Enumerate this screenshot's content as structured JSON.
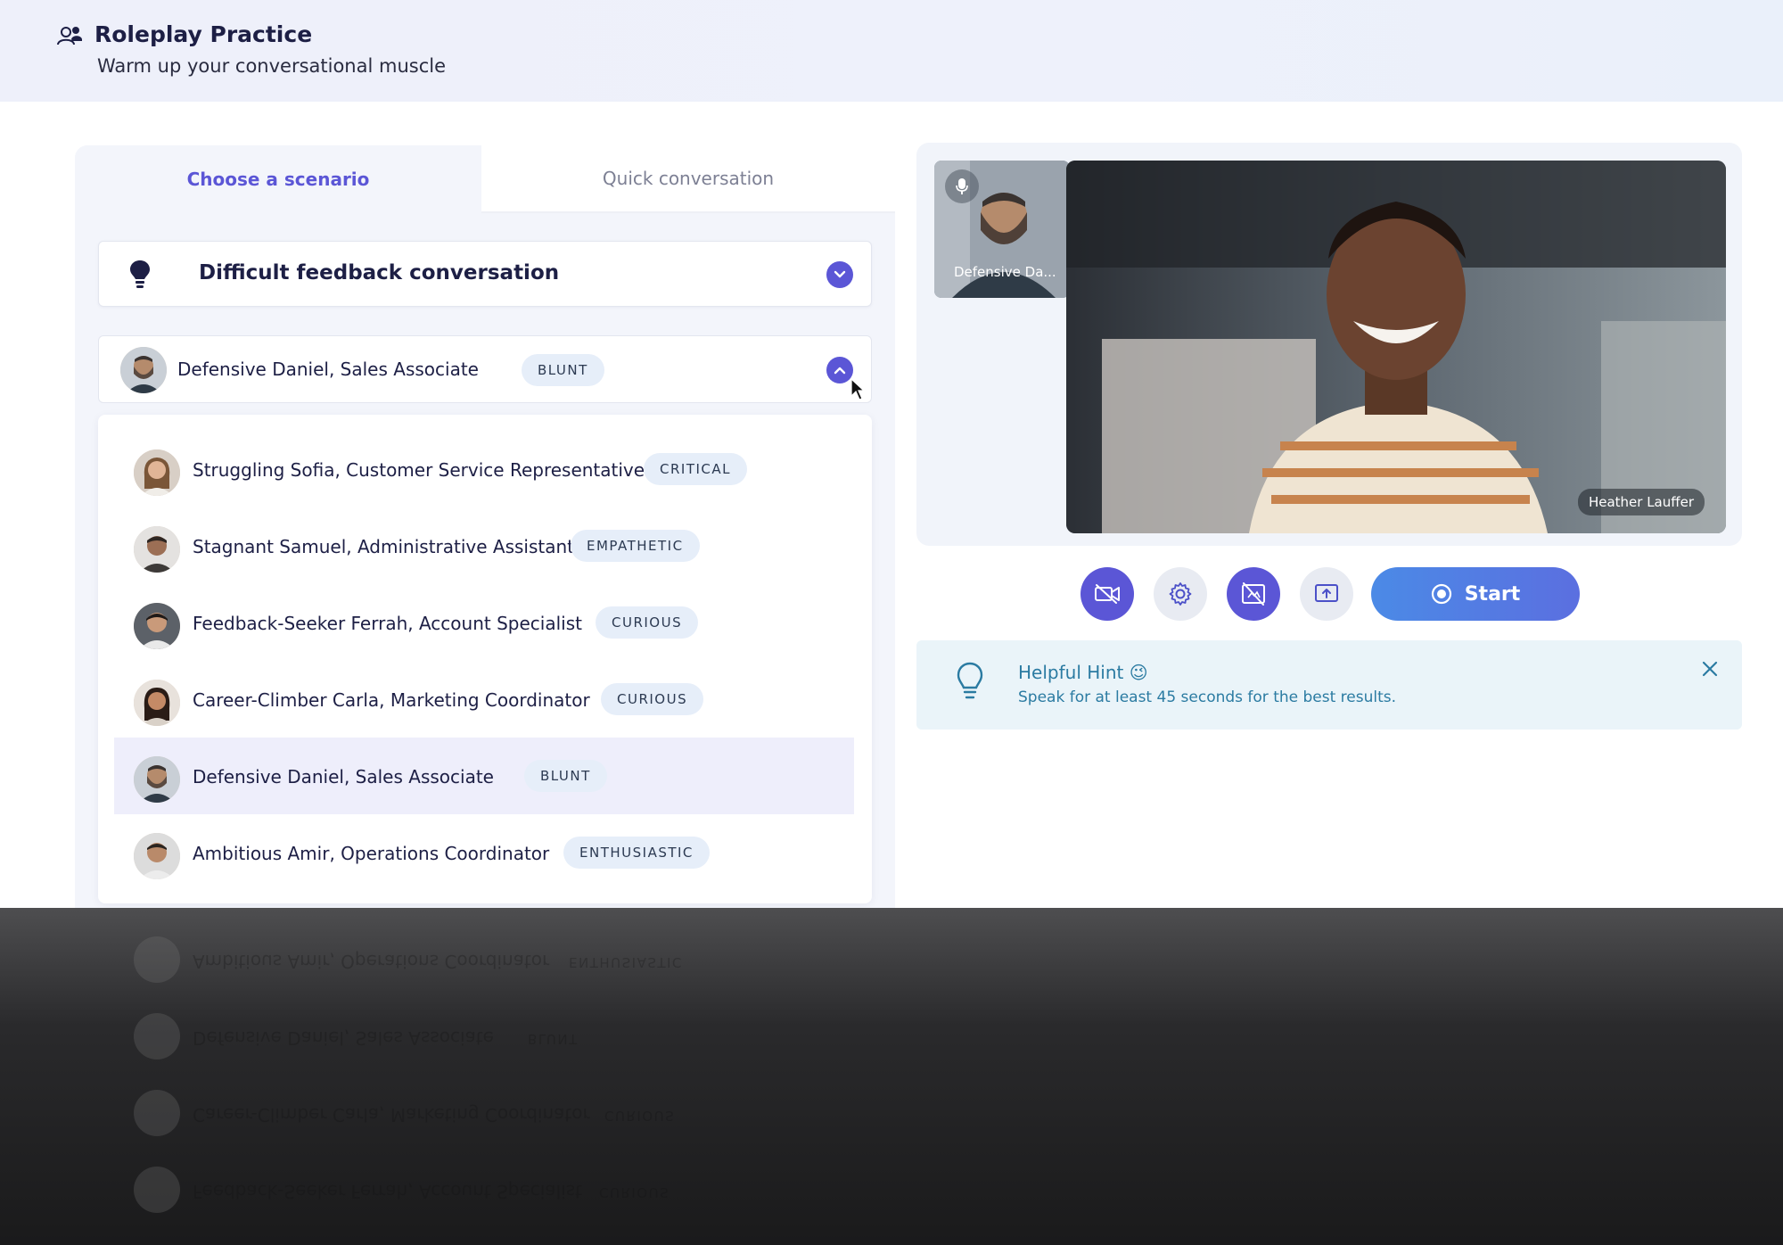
{
  "header": {
    "title": "Roleplay Practice",
    "subtitle": "Warm up your conversational muscle",
    "icon": "users-icon"
  },
  "tabs": [
    {
      "label": "Choose a scenario",
      "active": true
    },
    {
      "label": "Quick conversation",
      "active": false
    }
  ],
  "scenario": {
    "label": "Difficult feedback conversation",
    "icon": "lightbulb-icon",
    "expanded": false
  },
  "persona_select": {
    "name": "Defensive Daniel, Sales Associate",
    "badge": "BLUNT",
    "expanded": true
  },
  "personas": [
    {
      "name": "Struggling Sofia, Customer Service Representative",
      "badge": "CRITICAL",
      "selected": false
    },
    {
      "name": "Stagnant Samuel, Administrative Assistant",
      "badge": "EMPATHETIC",
      "selected": false
    },
    {
      "name": "Feedback-Seeker Ferrah, Account Specialist",
      "badge": "CURIOUS",
      "selected": false
    },
    {
      "name": "Career-Climber Carla, Marketing Coordinator",
      "badge": "CURIOUS",
      "selected": false
    },
    {
      "name": "Defensive Daniel, Sales Associate",
      "badge": "BLUNT",
      "selected": true
    },
    {
      "name": "Ambitious Amir, Operations Coordinator",
      "badge": "ENTHUSIASTIC",
      "selected": false
    }
  ],
  "video": {
    "thumbnail_label": "Defensive Da...",
    "main_label": "Heather Lauffer"
  },
  "controls": {
    "start_label": "Start"
  },
  "hint": {
    "title": "Helpful Hint 😉",
    "text": "Speak for at least 45 seconds for the best results."
  },
  "colors": {
    "accent": "#5b56d6",
    "start_gradient_from": "#4b8ae6",
    "start_gradient_to": "#5b6fe0",
    "hint_text": "#2b7ba2",
    "badge_bg": "#e6eef9"
  }
}
